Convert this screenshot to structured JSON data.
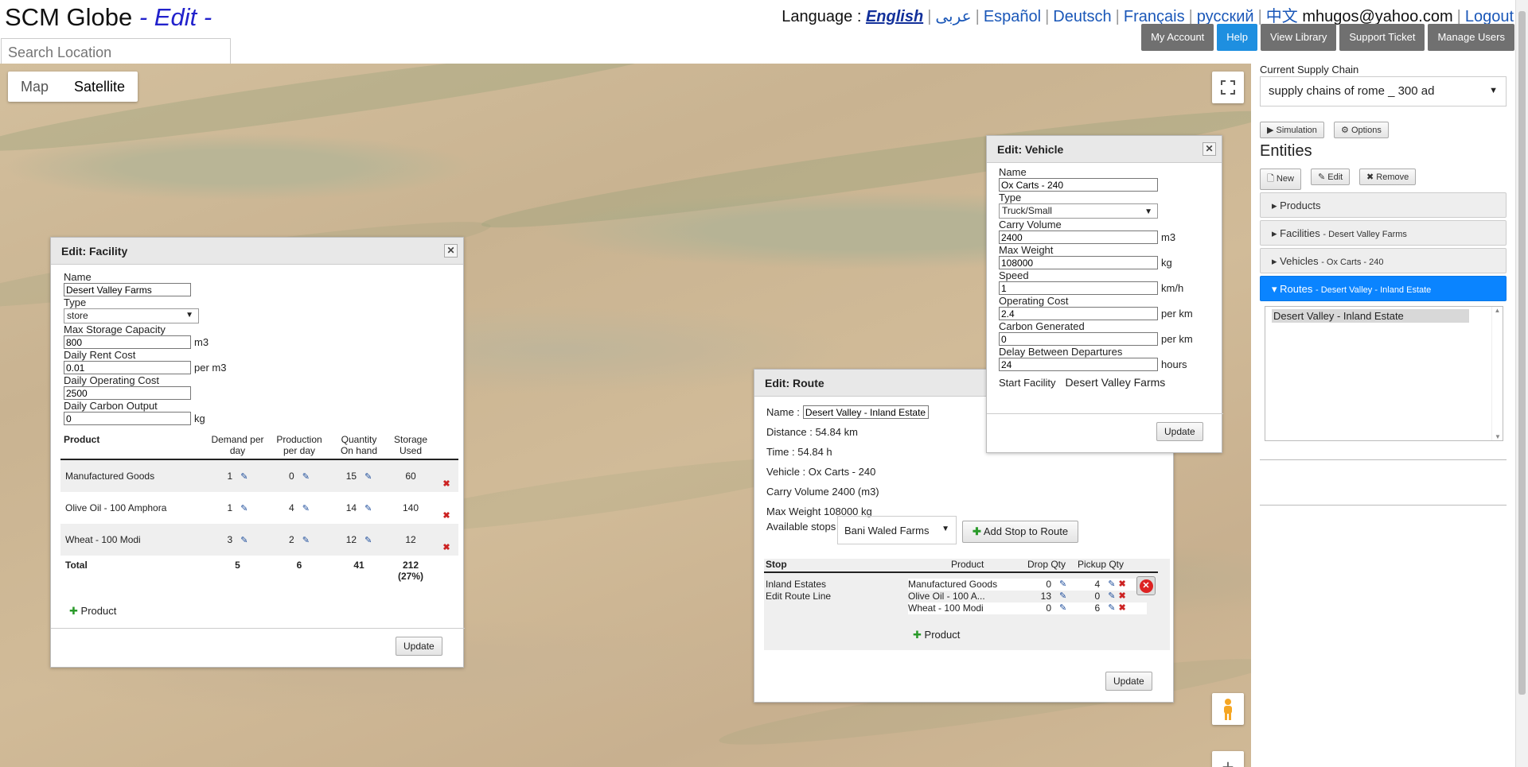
{
  "header": {
    "app_name": "SCM Globe",
    "mode_label": "- Edit -",
    "language_label": "Language :",
    "languages": [
      "English",
      "عربى",
      "Español",
      "Deutsch",
      "Français",
      "русский",
      "中文"
    ],
    "user_email": "mhugos@yahoo.com",
    "logout_label": "Logout",
    "nav": [
      "My Account",
      "Help",
      "View Library",
      "Support Ticket",
      "Manage Users"
    ]
  },
  "search": {
    "placeholder": "Search Location"
  },
  "map": {
    "types": [
      "Map",
      "Satellite"
    ],
    "active_type": "Satellite",
    "zoom_in": "+"
  },
  "facility_dialog": {
    "title": "Edit: Facility",
    "name_label": "Name",
    "name_value": "Desert Valley Farms",
    "type_label": "Type",
    "type_value": "store",
    "storage_label": "Max Storage Capacity",
    "storage_value": "800",
    "storage_unit": "m3",
    "rent_label": "Daily Rent Cost",
    "rent_value": "0.01",
    "rent_unit": "per m3",
    "opcost_label": "Daily Operating Cost",
    "opcost_value": "2500",
    "carbon_label": "Daily Carbon Output",
    "carbon_value": "0",
    "carbon_unit": "kg",
    "columns": [
      "Product",
      "Demand per day",
      "Production per day",
      "Quantity On hand",
      "Storage Used"
    ],
    "rows": [
      {
        "product": "Manufactured Goods",
        "demand": "1",
        "production": "0",
        "onhand": "15",
        "storage": "60"
      },
      {
        "product": "Olive Oil - 100 Amphora",
        "demand": "1",
        "production": "4",
        "onhand": "14",
        "storage": "140"
      },
      {
        "product": "Wheat - 100 Modi",
        "demand": "3",
        "production": "2",
        "onhand": "12",
        "storage": "12"
      }
    ],
    "total": {
      "label": "Total",
      "demand": "5",
      "production": "6",
      "onhand": "41",
      "storage": "212",
      "storage_pct": "(27%)"
    },
    "add_product": "Product",
    "update": "Update"
  },
  "route_dialog": {
    "title": "Edit: Route",
    "name_label": "Name :",
    "name_value": "Desert Valley - Inland Estate",
    "distance_label": "Distance :",
    "distance_value": "54.84 km",
    "time_label": "Time :",
    "time_value": "54.84 h",
    "vehicle_label": "Vehicle :",
    "vehicle_value": "Ox Carts - 240",
    "carry_label": "Carry Volume",
    "carry_value": "2400 (m3)",
    "weight_label": "Max Weight",
    "weight_value": "108000 kg",
    "stops_label": "Available stops",
    "stops_value": "Bani Waled Farms",
    "add_stop": "Add Stop to Route",
    "columns": [
      "Stop",
      "Product",
      "Drop Qty",
      "Pickup Qty"
    ],
    "stop_name": "Inland Estates",
    "edit_line": "Edit Route Line",
    "lines": [
      {
        "product": "Manufactured Goods",
        "drop": "0",
        "pickup": "4"
      },
      {
        "product": "Olive Oil - 100 A...",
        "drop": "13",
        "pickup": "0"
      },
      {
        "product": "Wheat - 100 Modi",
        "drop": "0",
        "pickup": "6"
      }
    ],
    "add_product": "Product",
    "update": "Update"
  },
  "vehicle_dialog": {
    "title": "Edit: Vehicle",
    "name_label": "Name",
    "name_value": "Ox Carts - 240",
    "type_label": "Type",
    "type_value": "Truck/Small",
    "volume_label": "Carry Volume",
    "volume_value": "2400",
    "volume_unit": "m3",
    "weight_label": "Max Weight",
    "weight_value": "108000",
    "weight_unit": "kg",
    "speed_label": "Speed",
    "speed_value": "1",
    "speed_unit": "km/h",
    "opcost_label": "Operating Cost",
    "opcost_value": "2.4",
    "opcost_unit": "per km",
    "carbon_label": "Carbon Generated",
    "carbon_value": "0",
    "carbon_unit": "per km",
    "delay_label": "Delay Between Departures",
    "delay_value": "24",
    "delay_unit": "hours",
    "start_label": "Start Facility",
    "start_value": "Desert Valley Farms",
    "update": "Update"
  },
  "right_panel": {
    "chain_label": "Current Supply Chain",
    "chain_value": "supply chains of rome _ 300 ad",
    "simulation": "Simulation",
    "options": "Options",
    "entities_title": "Entities",
    "new": "New",
    "edit": "Edit",
    "remove": "Remove",
    "accordion": [
      {
        "label": "Products",
        "sub": ""
      },
      {
        "label": "Facilities",
        "sub": "- Desert Valley Farms"
      },
      {
        "label": "Vehicles",
        "sub": "- Ox Carts - 240"
      },
      {
        "label": "Routes",
        "sub": "- Desert Valley - Inland Estate"
      }
    ],
    "route_items": [
      "Desert Valley - Inland Estate"
    ]
  },
  "colors": {
    "accent": "#0a84ff",
    "help": "#1e8fe0",
    "nav": "#707070",
    "mode": "#2222cc"
  }
}
